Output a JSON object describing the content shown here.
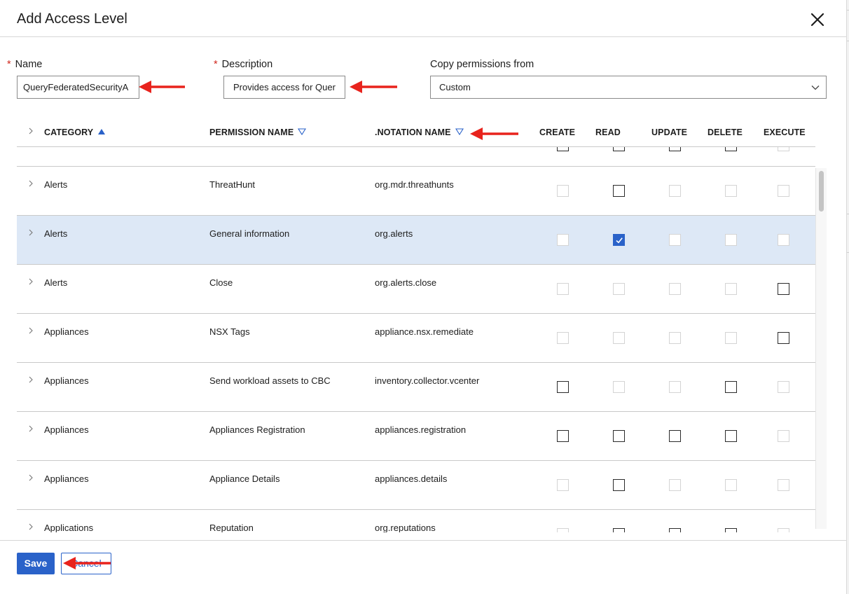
{
  "dialog": {
    "title": "Add Access Level",
    "close_icon": "close-icon"
  },
  "form": {
    "name": {
      "label": "Name",
      "required_mark": "*",
      "value": "QueryFederatedSecurityA"
    },
    "description": {
      "label": "Description",
      "required_mark": "*",
      "value": "Provides access for Quer"
    },
    "copy_from": {
      "label": "Copy permissions from",
      "value": "Custom"
    }
  },
  "table": {
    "columns": {
      "category": "CATEGORY",
      "permission": "PERMISSION NAME",
      "notation": ".NOTATION NAME",
      "create": "CREATE",
      "read": "READ",
      "update": "UPDATE",
      "delete": "DELETE",
      "execute": "EXECUTE"
    },
    "sort": {
      "category": "ascending-active",
      "permission": "descending-inactive",
      "notation": "descending-inactive"
    },
    "rows": [
      {
        "category": "Alerts",
        "permission": "ThreatHunt",
        "notation": "org.mdr.threathunts",
        "checks": [
          "disabled",
          "enabled",
          "disabled",
          "disabled",
          "disabled"
        ],
        "selected": false
      },
      {
        "category": "Alerts",
        "permission": "General information",
        "notation": "org.alerts",
        "checks": [
          "disabled",
          "checked",
          "disabled",
          "disabled",
          "disabled"
        ],
        "selected": true
      },
      {
        "category": "Alerts",
        "permission": "Close",
        "notation": "org.alerts.close",
        "checks": [
          "disabled",
          "disabled",
          "disabled",
          "disabled",
          "enabled"
        ],
        "selected": false
      },
      {
        "category": "Appliances",
        "permission": "NSX Tags",
        "notation": "appliance.nsx.remediate",
        "checks": [
          "disabled",
          "disabled",
          "disabled",
          "disabled",
          "enabled"
        ],
        "selected": false
      },
      {
        "category": "Appliances",
        "permission": "Send workload assets to CBC",
        "notation": "inventory.collector.vcenter",
        "checks": [
          "enabled",
          "disabled",
          "disabled",
          "enabled",
          "disabled"
        ],
        "selected": false
      },
      {
        "category": "Appliances",
        "permission": "Appliances Registration",
        "notation": "appliances.registration",
        "checks": [
          "enabled",
          "enabled",
          "enabled",
          "enabled",
          "disabled"
        ],
        "selected": false
      },
      {
        "category": "Appliances",
        "permission": "Appliance Details",
        "notation": "appliances.details",
        "checks": [
          "disabled",
          "enabled",
          "disabled",
          "disabled",
          "disabled"
        ],
        "selected": false
      },
      {
        "category": "Applications",
        "permission": "Reputation",
        "notation": "org.reputations",
        "checks": [
          "disabled",
          "enabled",
          "enabled",
          "enabled",
          "disabled"
        ],
        "selected": false
      }
    ]
  },
  "footer": {
    "save_label": "Save",
    "cancel_label": "Cancel"
  },
  "colors": {
    "primary": "#2a62c9",
    "required": "#d0271d",
    "annotation_arrow": "#e8231d",
    "selected_row": "#dde8f6"
  }
}
